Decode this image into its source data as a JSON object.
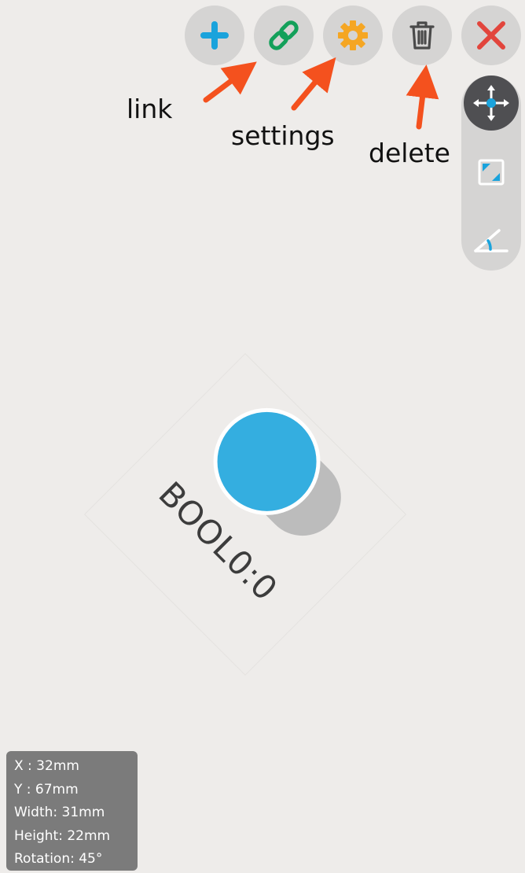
{
  "toolbar": {
    "items": [
      {
        "name": "add",
        "icon": "plus-icon",
        "color": "#1aa3dc"
      },
      {
        "name": "link",
        "icon": "link-icon",
        "color": "#13a05a"
      },
      {
        "name": "settings",
        "icon": "gear-icon",
        "color": "#f5a623"
      },
      {
        "name": "delete",
        "icon": "trash-icon",
        "color": "#4a4a4a"
      },
      {
        "name": "close",
        "icon": "close-icon",
        "color": "#e2453c"
      }
    ]
  },
  "annotations": {
    "link": "link",
    "settings": "settings",
    "delete": "delete",
    "arrow_color": "#f4511e"
  },
  "side_tools": {
    "items": [
      {
        "name": "move",
        "icon": "move-arrows-icon",
        "active": true
      },
      {
        "name": "resize",
        "icon": "resize-icon",
        "active": false
      },
      {
        "name": "rotate",
        "icon": "rotate-angle-icon",
        "active": false
      }
    ]
  },
  "widget": {
    "label": "BOOL0:0",
    "knob_color": "#34aee0",
    "track_color": "#bcbcbc"
  },
  "info": {
    "x": "X  : 32mm",
    "y": "Y  : 67mm",
    "width": "Width: 31mm",
    "height": "Height: 22mm",
    "rotation": "Rotation: 45°"
  }
}
